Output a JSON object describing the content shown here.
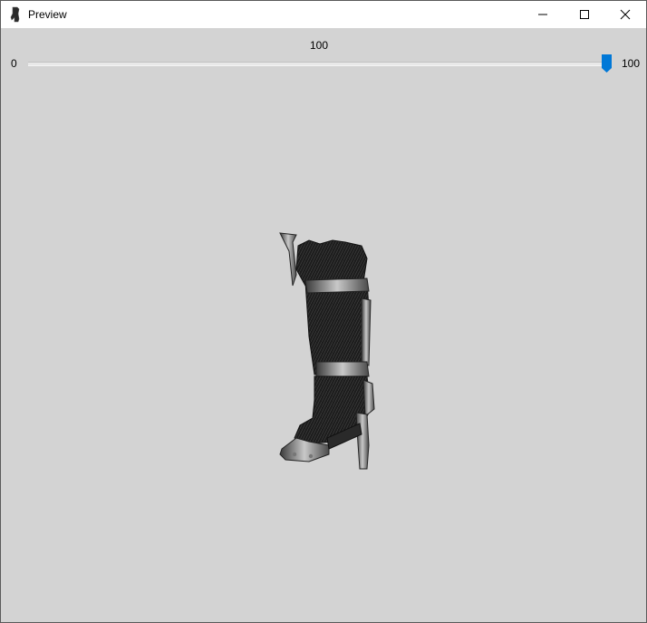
{
  "window": {
    "title": "Preview",
    "icon": "boot-icon",
    "controls": {
      "minimize": "minimize-icon",
      "maximize": "maximize-icon",
      "close": "close-icon"
    }
  },
  "slider": {
    "value": 100,
    "value_label": "100",
    "min_label": "0",
    "max_label": "100",
    "accent": "#0078d7"
  },
  "preview": {
    "subject": "boot-model",
    "background": "#d3d3d3"
  }
}
